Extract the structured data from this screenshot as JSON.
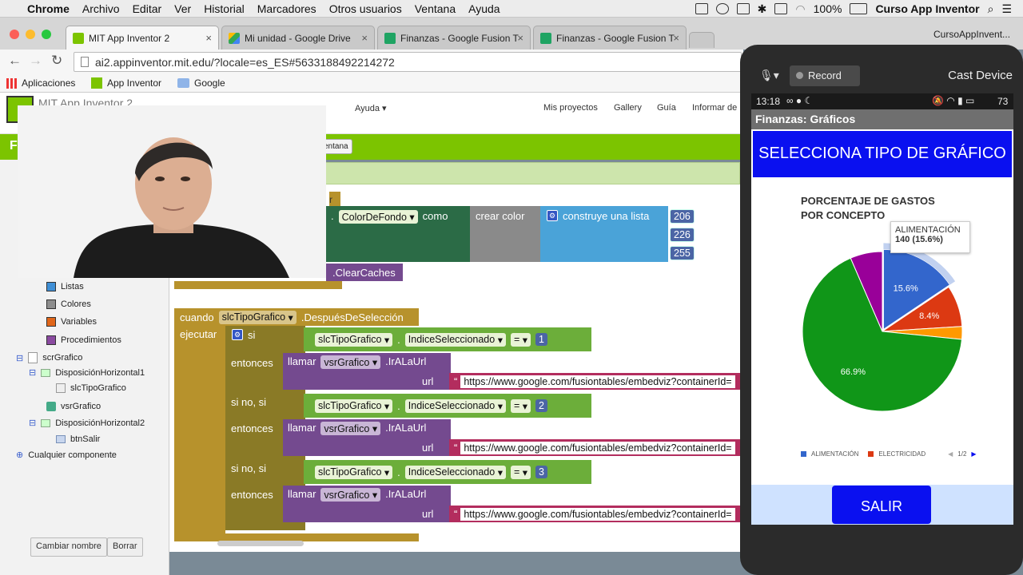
{
  "menubar": {
    "items": [
      "Chrome",
      "Archivo",
      "Editar",
      "Ver",
      "Historial",
      "Marcadores",
      "Otros usuarios",
      "Ventana",
      "Ayuda"
    ],
    "battery": "100%",
    "right_title": "Curso App Inventor"
  },
  "tabs": [
    {
      "label": "MIT App Inventor 2",
      "close": "×"
    },
    {
      "label": "Mi unidad - Google Drive",
      "close": "×"
    },
    {
      "label": "Finanzas - Google Fusion T",
      "close": "×"
    },
    {
      "label": "Finanzas - Google Fusion T",
      "close": "×"
    }
  ],
  "profile_label": "CursoAppInvent...",
  "url": "ai2.appinventor.mit.edu/?locale=es_ES#5633188492214272",
  "bookmarks": [
    "Aplicaciones",
    "App Inventor",
    "Google"
  ],
  "appheader": {
    "logo_text": "MIT App Inventor 2",
    "ayuda": "Ayuda ▾",
    "links": [
      "Mis proyectos",
      "Gallery",
      "Guía",
      "Informar de"
    ]
  },
  "greenbar_letter": "F",
  "ventana_label": "entana",
  "tree": {
    "builtin": [
      {
        "label": "Listas",
        "color": "#3f8fd6"
      },
      {
        "label": "Colores",
        "color": "#8e8e8e"
      },
      {
        "label": "Variables",
        "color": "#e0661a"
      },
      {
        "label": "Procedimientos",
        "color": "#8a4aa0"
      }
    ],
    "components": [
      "scrGrafico",
      "DisposiciónHorizontal1",
      "slcTipoGrafico",
      "vsrGrafico",
      "DisposiciónHorizontal2",
      "btnSalir"
    ],
    "any": "Cualquier componente"
  },
  "panel_buttons": [
    "Cambiar nombre",
    "Borrar"
  ],
  "blocks": {
    "top_text_fragment": "r",
    "colordefondo": "ColorDeFondo",
    "como": "como",
    "crear_color": "crear color",
    "construye": "construye una lista",
    "rgb": [
      "206",
      "226",
      "255"
    ],
    "clearcaches": ".ClearCaches",
    "cuando": "cuando",
    "event_component": "slcTipoGrafico",
    "event_name": ".DespuésDeSelección",
    "ejecutar": "ejecutar",
    "si": "si",
    "sino_si": "si no, si",
    "entonces": "entonces",
    "llamar": "llamar",
    "vsr": "vsrGrafico",
    "iralaurl": ".IrALaUrl",
    "url": "url",
    "dot": ".",
    "indice": "IndiceSeleccionado",
    "eq": "=",
    "conds": [
      "1",
      "2",
      "3"
    ],
    "url_text": "https://www.google.com/fusiontables/embedviz?containerId="
  },
  "device": {
    "record": "Record",
    "cast": "Cast Device",
    "time": "13:18",
    "battery": "73",
    "app_title": "Finanzas: Gráficos",
    "select_label": "SELECCIONA TIPO DE GRÁFICO",
    "exit_label": "SALIR",
    "legend_page": "1/2"
  },
  "chart_data": {
    "type": "pie",
    "title": "PORCENTAJE DE GASTOS POR CONCEPTO",
    "slices": [
      {
        "name": "ALIMENTACIÓN",
        "value": 15.6,
        "color": "#3366cc"
      },
      {
        "name": "ELECTRICIDAD",
        "value": 8.4,
        "color": "#dc3912"
      },
      {
        "name": "",
        "value": 2.6,
        "color": "#ff9900"
      },
      {
        "name": "",
        "value": 66.9,
        "color": "#109618"
      },
      {
        "name": "",
        "value": 6.5,
        "color": "#990099"
      }
    ],
    "slice_labels": [
      "15.6%",
      "8.4%",
      "66.9%"
    ],
    "tooltip": {
      "title": "ALIMENTACIÓN",
      "value": "140 (15.6%)"
    },
    "legend": [
      "ALIMENTACIÓN",
      "ELECTRICIDAD"
    ],
    "legend_position": "bottom"
  }
}
